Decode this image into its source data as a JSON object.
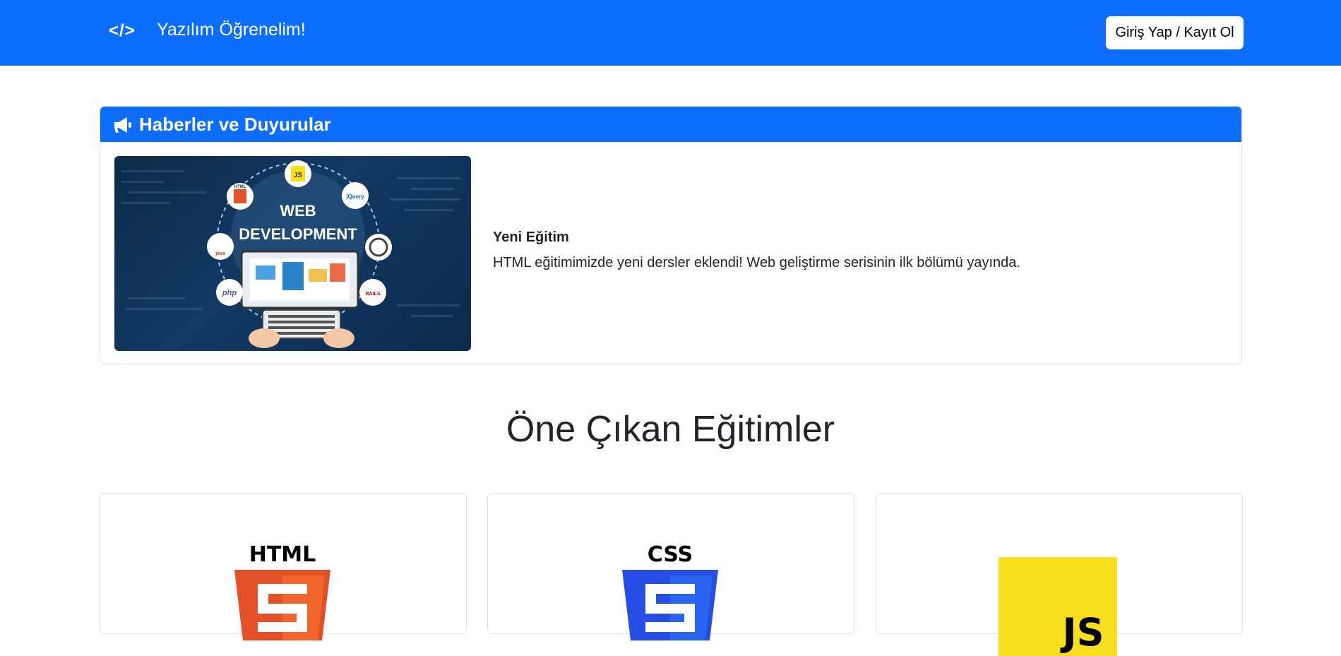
{
  "navbar": {
    "brand_icon": "</>",
    "brand_text": "Yazılım Öğrenelim!",
    "login_button": "Giriş Yap / Kayıt Ol",
    "background": "#0d6efd"
  },
  "news": {
    "header_icon": "megaphone-icon",
    "header_title": "Haberler ve Duyurular",
    "image": {
      "line1": "WEB",
      "line2": "DEVELOPMENT",
      "badges": [
        "JS",
        "HTML",
        "jQuery",
        "java",
        "php",
        "RAILS"
      ]
    },
    "item_title": "Yeni Eğitim",
    "item_body": "HTML eğitimimizde yeni dersler eklendi! Web geliştirme serisinin ilk bölümü yayında."
  },
  "featured": {
    "title": "Öne Çıkan Eğitimler",
    "courses": [
      {
        "logo_text": "HTML",
        "logo_color": "#e34f26"
      },
      {
        "logo_text": "CSS",
        "logo_color": "#264de4"
      },
      {
        "logo_text": "JS",
        "logo_color": "#f7df1e"
      }
    ]
  }
}
